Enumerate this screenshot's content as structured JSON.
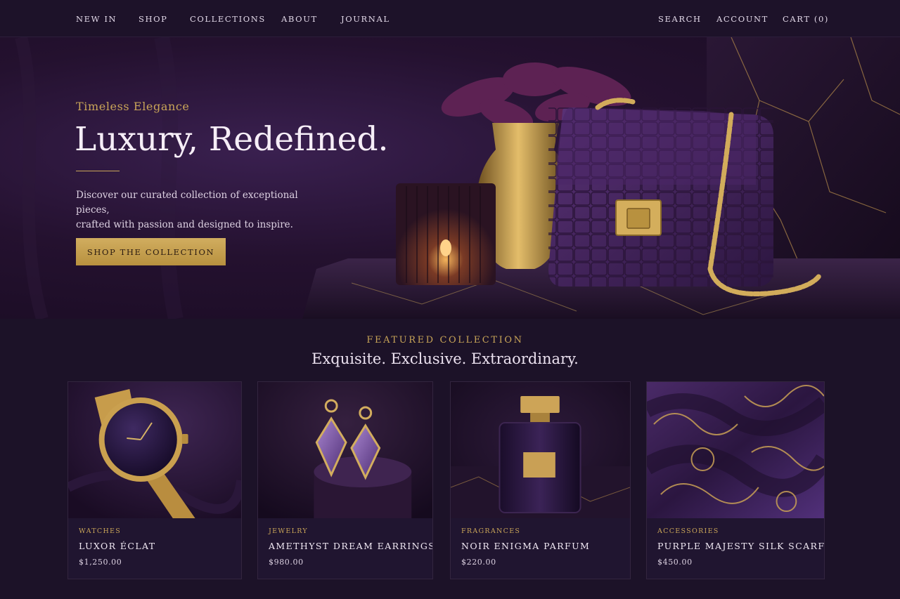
{
  "nav": {
    "left": [
      "NEW IN",
      "SHOP",
      "COLLECTIONS",
      "ABOUT",
      "JOURNAL"
    ],
    "search": "SEARCH",
    "account": "ACCOUNT",
    "cart": "CART (0)"
  },
  "hero": {
    "eyebrow": "Timeless Elegance",
    "headline": "Luxury, Redefined.",
    "body_line1": "Discover our curated collection of exceptional pieces,",
    "body_line2": "crafted with passion and designed to inspire.",
    "cta": "SHOP THE COLLECTION"
  },
  "featured": {
    "eyebrow": "FEATURED COLLECTION",
    "title": "Exquisite. Exclusive. Extraordinary.",
    "products": [
      {
        "category": "WATCHES",
        "name": "LUXOR ÉCLAT",
        "price": "$1,250.00"
      },
      {
        "category": "JEWELRY",
        "name": "AMETHYST DREAM EARRINGS",
        "price": "$980.00"
      },
      {
        "category": "FRAGRANCES",
        "name": "NOIR ENIGMA PARFUM",
        "price": "$220.00"
      },
      {
        "category": "ACCESSORIES",
        "name": "PURPLE MAJESTY SILK SCARF",
        "price": "$450.00"
      }
    ]
  },
  "colors": {
    "accent_gold": "#c9a558",
    "background": "#1c1228",
    "card": "#201530"
  }
}
